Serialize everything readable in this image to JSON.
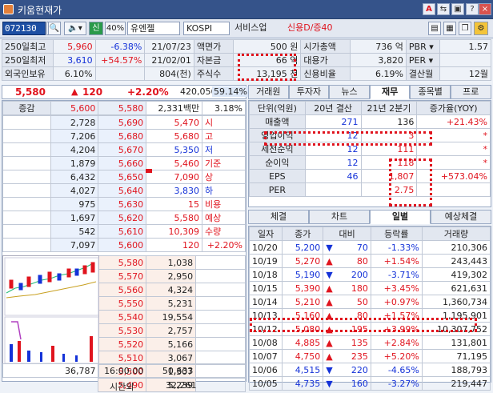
{
  "window": {
    "title": "키움현재가"
  },
  "toolbar": {
    "code": "072130",
    "ratio": "40%",
    "name": "유엔젤",
    "market": "KOSPI",
    "sector": "서비스업",
    "credit": "신용D/증40",
    "btn_a": "A",
    "btn_s": "신"
  },
  "info": [
    [
      {
        "l": "250일최고",
        "v": "5,960",
        "p": "-6.38%",
        "d": "21/07/23"
      },
      {
        "l": "액면가",
        "v": "500 원"
      },
      {
        "l": "시가총액",
        "v": "736 억"
      },
      {
        "l": "PBR",
        "v": "1.57"
      }
    ],
    [
      {
        "l": "250일최저",
        "v": "3,610",
        "p": "+54.57%",
        "d": "21/02/01"
      },
      {
        "l": "자본금",
        "v": "66 억"
      },
      {
        "l": "대용가",
        "v": "3,820"
      },
      {
        "l": "PER",
        "v": ""
      }
    ],
    [
      {
        "l": "외국인보유",
        "v": "6.10%",
        "p": "",
        "d": "804(천)"
      },
      {
        "l": "주식수",
        "v": "13,195 천"
      },
      {
        "l": "신용비율",
        "v": "6.19%"
      },
      {
        "l": "결산월",
        "v": "12월"
      }
    ]
  ],
  "quote": {
    "price": "5,580",
    "change": "120",
    "rate": "+2.20%",
    "volume": "420,056",
    "vol_rate": "59.14%"
  },
  "hoga_head": {
    "label": "증감",
    "p1": "5,600",
    "p2": "5,580",
    "amt": "2,331백만",
    "pct": "3.18%"
  },
  "asks": [
    {
      "q": "2,728",
      "p": "5,690",
      "s": "5,470",
      "k": "시"
    },
    {
      "q": "7,206",
      "p": "5,680",
      "s": "5,680",
      "k": "고"
    },
    {
      "q": "4,204",
      "p": "5,670",
      "s": "5,350",
      "k": "저"
    },
    {
      "q": "1,879",
      "p": "5,660",
      "s": "5,460",
      "k": "기준"
    },
    {
      "q": "6,432",
      "p": "5,650",
      "s": "7,090",
      "k": "상"
    },
    {
      "q": "4,027",
      "p": "5,640",
      "s": "3,830",
      "k": "하"
    },
    {
      "q": "975",
      "p": "5,630",
      "s": "15",
      "k": "비용"
    },
    {
      "q": "1,697",
      "p": "5,620",
      "s": "5,580",
      "k": "예상"
    },
    {
      "q": "542",
      "p": "5,610",
      "s": "10,309",
      "k": "수량"
    },
    {
      "q": "7,097",
      "p": "5,600",
      "s": "120",
      "k": "+2.20%"
    }
  ],
  "bids": [
    {
      "p": "5,580",
      "q": "1,038"
    },
    {
      "p": "5,570",
      "q": "2,950"
    },
    {
      "p": "5,560",
      "q": "4,324"
    },
    {
      "p": "5,550",
      "q": "5,231"
    },
    {
      "p": "5,540",
      "q": "19,554"
    },
    {
      "p": "5,530",
      "q": "2,757"
    },
    {
      "p": "5,520",
      "q": "5,166"
    },
    {
      "p": "5,510",
      "q": "3,067"
    },
    {
      "p": "5,500",
      "q": "1,307"
    },
    {
      "p": "5,490",
      "q": "5,239"
    }
  ],
  "hoga_foot": {
    "ask_total": "36,787",
    "time": "16:00:00",
    "bid_total": "50,633",
    "after": "시간외",
    "after_total": "32,261"
  },
  "top_tabs": [
    "거래원",
    "투자자",
    "뉴스",
    "재무",
    "종목별",
    "프로"
  ],
  "fin": {
    "head": [
      "단위(억원)",
      "20년 결산",
      "21년 2분기",
      "증가율(YOY)"
    ],
    "rows": [
      {
        "k": "매출액",
        "a": "271",
        "b": "136",
        "c": "+21.43%"
      },
      {
        "k": "영업이익",
        "a": "12",
        "b": "3",
        "c": "*"
      },
      {
        "k": "세전순익",
        "a": "12",
        "b": "111",
        "c": "*"
      },
      {
        "k": "순이익",
        "a": "12",
        "b": "118",
        "c": "*"
      },
      {
        "k": "EPS",
        "a": "46",
        "b": "1,807",
        "c": "+573.04%"
      },
      {
        "k": "PER",
        "a": "",
        "b": "2.75",
        "c": ""
      }
    ]
  },
  "bottom_tabs": [
    "체결",
    "차트",
    "일별",
    "예상체결"
  ],
  "daily": {
    "head": [
      "일자",
      "종가",
      "대비",
      "등락률",
      "거래량"
    ],
    "rows": [
      {
        "d": "10/20",
        "c": "5,200",
        "dir": "down",
        "ch": "70",
        "r": "-1.33%",
        "v": "210,306"
      },
      {
        "d": "10/19",
        "c": "5,270",
        "dir": "up",
        "ch": "80",
        "r": "+1.54%",
        "v": "243,443"
      },
      {
        "d": "10/18",
        "c": "5,190",
        "dir": "down",
        "ch": "200",
        "r": "-3.71%",
        "v": "419,302"
      },
      {
        "d": "10/15",
        "c": "5,390",
        "dir": "up",
        "ch": "180",
        "r": "+3.45%",
        "v": "621,631"
      },
      {
        "d": "10/14",
        "c": "5,210",
        "dir": "up",
        "ch": "50",
        "r": "+0.97%",
        "v": "1,360,734"
      },
      {
        "d": "10/13",
        "c": "5,160",
        "dir": "up",
        "ch": "80",
        "r": "+1.57%",
        "v": "1,195,901"
      },
      {
        "d": "10/12",
        "c": "5,080",
        "dir": "up",
        "ch": "195",
        "r": "+3.99%",
        "v": "10,307,752"
      },
      {
        "d": "10/08",
        "c": "4,885",
        "dir": "up",
        "ch": "135",
        "r": "+2.84%",
        "v": "131,801"
      },
      {
        "d": "10/07",
        "c": "4,750",
        "dir": "up",
        "ch": "235",
        "r": "+5.20%",
        "v": "71,195"
      },
      {
        "d": "10/06",
        "c": "4,515",
        "dir": "down",
        "ch": "220",
        "r": "-4.65%",
        "v": "188,793"
      },
      {
        "d": "10/05",
        "c": "4,735",
        "dir": "down",
        "ch": "160",
        "r": "-3.27%",
        "v": "219,447"
      }
    ]
  },
  "colors": {
    "up": "#e0141e",
    "down": "#1432d8",
    "titlebar": "#35538a"
  }
}
